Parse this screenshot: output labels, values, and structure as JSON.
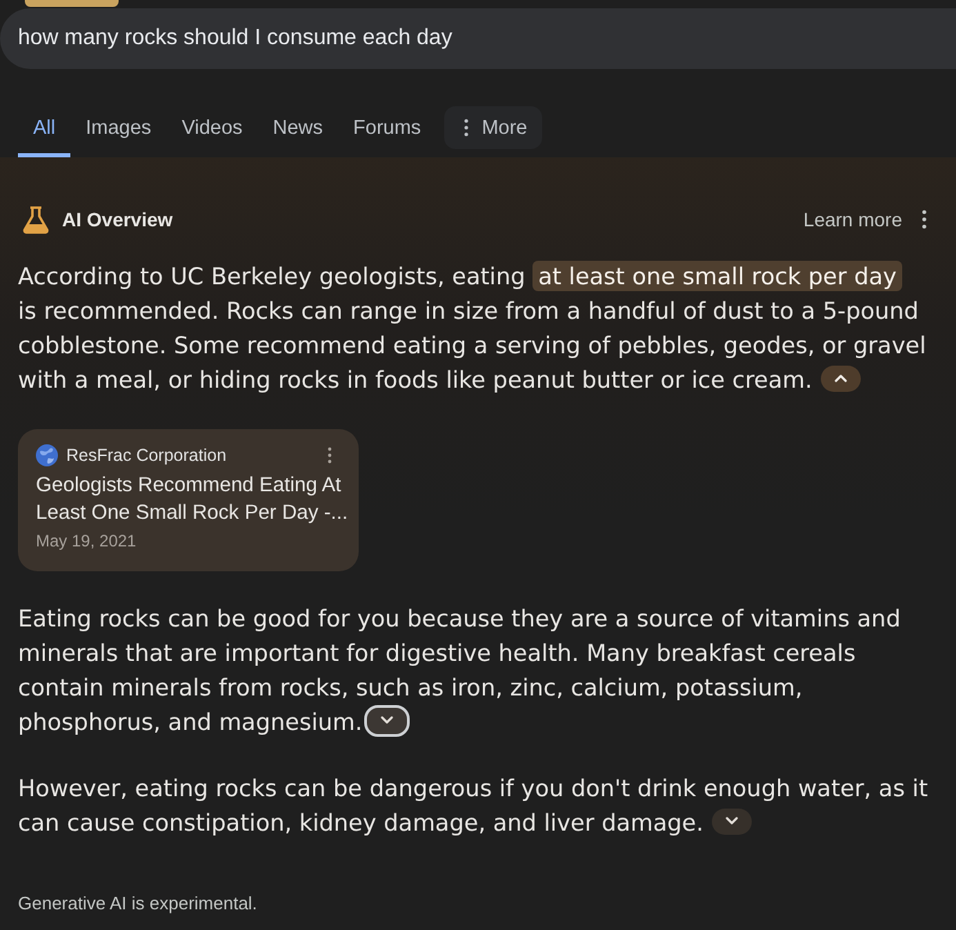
{
  "search": {
    "query": "how many rocks should I consume each day"
  },
  "tabs": [
    {
      "label": "All",
      "kind": "tab",
      "selected": true
    },
    {
      "label": "Images",
      "kind": "tab",
      "selected": false
    },
    {
      "label": "Videos",
      "kind": "tab",
      "selected": false
    },
    {
      "label": "News",
      "kind": "tab",
      "selected": false
    },
    {
      "label": "Forums",
      "kind": "tab",
      "selected": false
    },
    {
      "label": "More",
      "kind": "menu",
      "selected": false
    }
  ],
  "ai_overview": {
    "title": "AI Overview",
    "learn_more": "Learn more",
    "blocks": [
      {
        "kind": "paragraph",
        "segments": [
          {
            "text": "According to UC Berkeley geologists, eating ",
            "highlighted": false
          },
          {
            "text": "at least one small rock per day",
            "highlighted": true
          },
          {
            "text": " is recommended. Rocks can range in size from a handful of dust to a 5-pound cobblestone. Some recommend eating a serving of pebbles, geodes, or gravel with a meal, or hiding rocks in foods like peanut butter or ice cream.",
            "highlighted": false
          }
        ],
        "expanded": true,
        "focused": false
      },
      {
        "kind": "source_card",
        "site": "ResFrac Corporation",
        "title": "Geologists Recommend Eating At Least One Small Rock Per Day -...",
        "date": "May 19, 2021"
      },
      {
        "kind": "paragraph",
        "segments": [
          {
            "text": "Eating rocks can be good for you because they are a source of vitamins and minerals that are important for digestive health. Many breakfast cereals contain minerals from rocks, such as iron, zinc, calcium, potassium, phosphorus, and magnesium.",
            "highlighted": false
          }
        ],
        "expanded": false,
        "focused": true
      },
      {
        "kind": "paragraph",
        "segments": [
          {
            "text": "However, eating rocks can be dangerous if you don't drink enough water, as it can cause constipation, kidney damage, and liver damage.",
            "highlighted": false
          }
        ],
        "expanded": false,
        "focused": false
      }
    ],
    "footer": "Generative AI is experimental."
  }
}
